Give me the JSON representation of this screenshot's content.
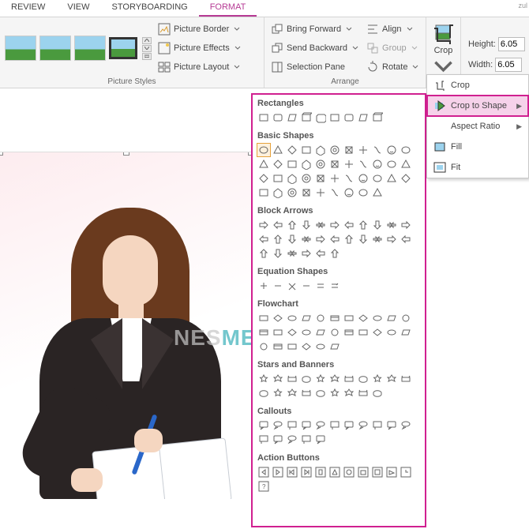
{
  "tabs": {
    "review": "REVIEW",
    "view": "VIEW",
    "storyboarding": "STORYBOARDING",
    "format": "FORMAT"
  },
  "user_hint": "zul",
  "ribbon": {
    "picture_styles": {
      "label": "Picture Styles",
      "border": "Picture Border",
      "effects": "Picture Effects",
      "layout": "Picture Layout"
    },
    "arrange": {
      "label": "Arrange",
      "bring_forward": "Bring Forward",
      "send_backward": "Send Backward",
      "selection_pane": "Selection Pane",
      "align": "Align",
      "group": "Group",
      "rotate": "Rotate"
    },
    "crop": {
      "label": "Crop"
    },
    "size": {
      "height_label": "Height:",
      "width_label": "Width:",
      "height_value": "6.05",
      "width_value": "6.05"
    }
  },
  "crop_menu": {
    "crop": "Crop",
    "crop_to_shape": "Crop to Shape",
    "aspect_ratio": "Aspect Ratio",
    "fill": "Fill",
    "fit": "Fit"
  },
  "shape_gallery": {
    "rectangles": "Rectangles",
    "basic_shapes": "Basic Shapes",
    "block_arrows": "Block Arrows",
    "equation_shapes": "Equation Shapes",
    "flowchart": "Flowchart",
    "stars_and_banners": "Stars and Banners",
    "callouts": "Callouts",
    "action_buttons": "Action Buttons",
    "counts": {
      "rectangles": 9,
      "basic_shapes": 42,
      "block_arrows": 28,
      "equation_shapes": 6,
      "flowchart": 28,
      "stars_and_banners": 20,
      "callouts": 16,
      "action_buttons": 12
    }
  },
  "watermark": {
    "left": "NES",
    "right": "MEDIA"
  }
}
